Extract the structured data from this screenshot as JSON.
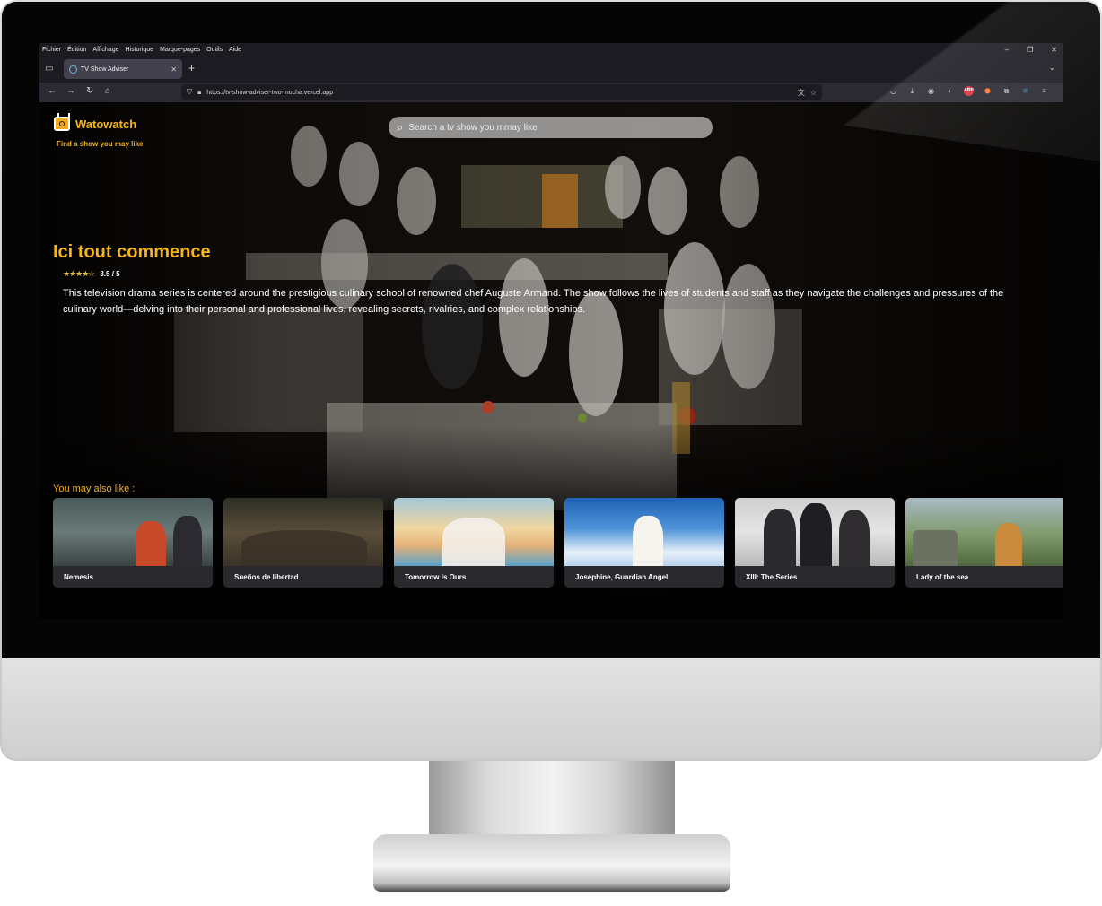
{
  "browser": {
    "menu": [
      "Fichier",
      "Édition",
      "Affichage",
      "Historique",
      "Marque-pages",
      "Outils",
      "Aide"
    ],
    "window_controls": [
      "–",
      "❐",
      "✕"
    ],
    "tab": {
      "title": "TV Show Adviser",
      "close": "✕"
    },
    "new_tab": "+",
    "url": "https://tv-show-adviser-two-mocha.vercel.app"
  },
  "app": {
    "name": "Watowatch",
    "tagline": "Find a show you may like",
    "search_placeholder": "Search a tv show you mmay like"
  },
  "featured": {
    "title": "Ici tout commence",
    "rating": 3.5,
    "rating_stars": "★★★★☆",
    "rating_text": "3.5 / 5",
    "overview": "This television drama series is centered around the prestigious culinary school of renowned chef Auguste Armand. The show follows the lives of students and staff as they navigate the challenges and pressures of the culinary world—delving into their personal and professional lives, revealing secrets, rivalries, and complex relationships."
  },
  "recommendations": {
    "heading": "You may also like :",
    "items": [
      {
        "title": "Nemesis"
      },
      {
        "title": "Sueños de libertad"
      },
      {
        "title": "Tomorrow Is Ours"
      },
      {
        "title": "Joséphine, Guardian Angel"
      },
      {
        "title": "XIII: The Series"
      },
      {
        "title": "Lady of the sea"
      }
    ]
  },
  "colors": {
    "accent": "#f6b51a",
    "browser_chrome": "#1c1b22",
    "navbar": "#2b2a33"
  }
}
